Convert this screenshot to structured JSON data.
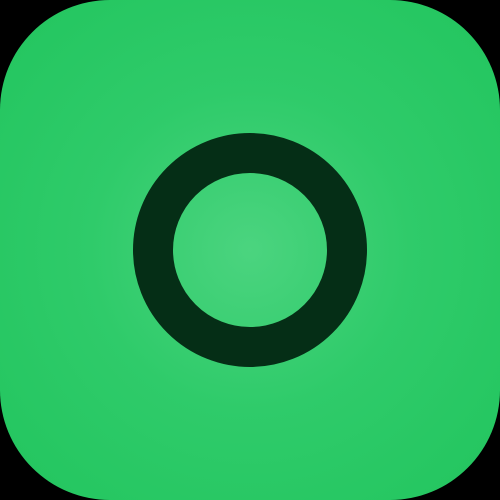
{
  "icon": {
    "name": "ring-icon",
    "colors": {
      "background": "#000000",
      "tile_center": "#4bd47f",
      "tile_edge": "#22c55e",
      "ring": "#052e16"
    }
  }
}
